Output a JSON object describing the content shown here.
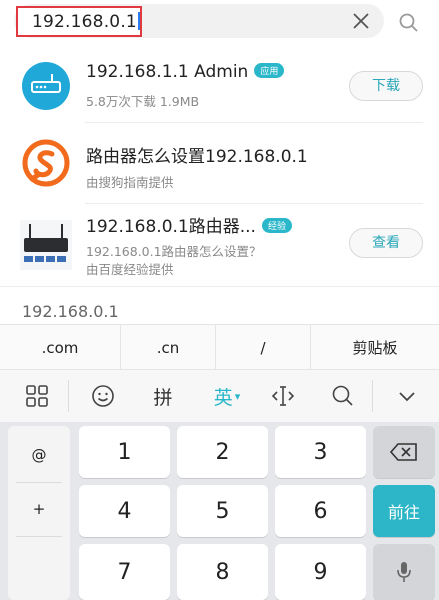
{
  "search": {
    "query": "192.168.0.1"
  },
  "results": [
    {
      "title": "192.168.1.1 Admin",
      "badge": "应用",
      "sub": "5.8万次下载 1.9MB",
      "button": "下载",
      "icon": "router-app-icon"
    },
    {
      "title": "路由器怎么设置192.168.0.1",
      "sub": "由搜狗指南提供",
      "icon": "sogou-logo-icon"
    },
    {
      "title": "192.168.0.1路由器...",
      "badge": "经验",
      "sub": "192.168.0.1路由器怎么设置？",
      "sub2": "由百度经验提供",
      "button": "查看",
      "icon": "router-photo-icon"
    }
  ],
  "suggestion": "192.168.0.1",
  "quickbar": [
    ".com",
    ".cn",
    "/",
    "剪贴板"
  ],
  "toolbar": {
    "pinyin": "拼",
    "english": "英",
    "english_caret": "▾"
  },
  "keyboard": {
    "side_keys": [
      "@",
      "+",
      ""
    ],
    "digits": [
      "1",
      "2",
      "3",
      "4",
      "5",
      "6",
      "7",
      "8",
      "9"
    ],
    "go_label": "前往"
  },
  "colors": {
    "accent": "#2ab7c9",
    "highlight_border": "#e0393e",
    "sogou_orange": "#f26a1b"
  }
}
